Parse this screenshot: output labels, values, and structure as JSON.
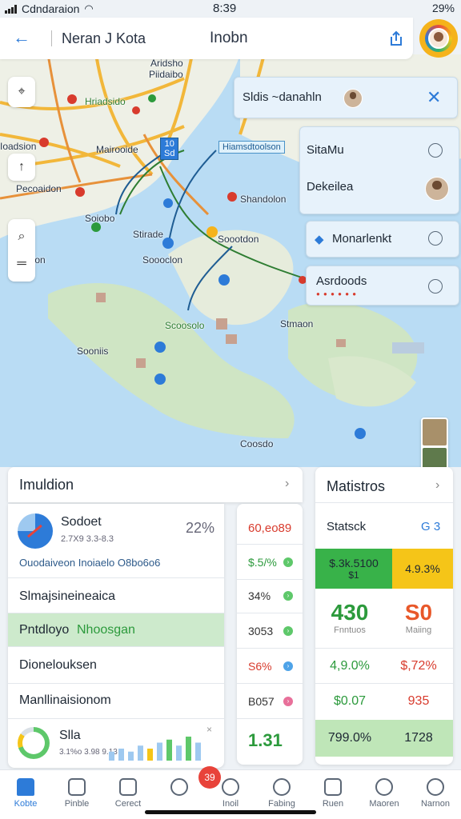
{
  "status_bar": {
    "carrier": "Cdndaraion",
    "time": "8:39",
    "battery": "29%"
  },
  "header": {
    "back_label": "←",
    "location_title": "Neran J Kota",
    "title": "Inobn"
  },
  "map": {
    "labels": [
      "Aridsho",
      "Piidaibo",
      "Hriadsido",
      "Ioadsion",
      "Mairooide",
      "Pecoaidon",
      "Soiobo",
      "Stirade",
      "Soooclon",
      "Pirdon",
      "Shandolon",
      "Soootdon",
      "Scoosolo",
      "Sooniis",
      "Stmaon",
      "Coosdo"
    ],
    "pin_box_label": "10\nSd",
    "route_box_label": "Hiamsdtoolson"
  },
  "search_popup": {
    "label": "Sldis ~danahln"
  },
  "side_popups": [
    {
      "label": "SitaMu"
    },
    {
      "label": "Dekeilea"
    },
    {
      "label": "Monarlenkt"
    },
    {
      "label": "Asrdoods",
      "sub": "● ● ● ● ● ●"
    }
  ],
  "info_panel": {
    "title": "Imuldion",
    "summary": {
      "name": "Sodoet",
      "detail": "2.7X9 3.3-8.3",
      "percent": "22%"
    },
    "link_row": "Ouodaiveon Inoiaelo O8bo6o6",
    "rows": [
      "Slmajsineineaica",
      "Pntdloyo",
      "Dionelouksen",
      "Manllinaisionom"
    ],
    "highlight_suffix": "Nhoosgan",
    "footer": {
      "name": "Slla",
      "detail": "3.1%o 3.98 9.13"
    }
  },
  "mid_column": {
    "header": "60,eo89",
    "values": [
      "$.5/%",
      "34%",
      "3053",
      "S6%",
      "B057"
    ],
    "total": "1.31"
  },
  "stats_panel": {
    "title": "Matistros",
    "subtitle": "Statsck",
    "subvalue": "G 3",
    "cells": [
      {
        "value": "$.3k.5100",
        "sub": "$1"
      },
      {
        "value": "4.9.3%"
      },
      {
        "value": "430",
        "sub": "Fnntuos"
      },
      {
        "value": "S0",
        "sub": "Maiing"
      },
      {
        "value": "4,9.0%"
      },
      {
        "value": "$,72%"
      },
      {
        "value": "$0.07"
      },
      {
        "value": "935"
      },
      {
        "value": "799.0%"
      },
      {
        "value": "1728"
      }
    ]
  },
  "sparkline": [
    3,
    4,
    3,
    5,
    4,
    6,
    7,
    5,
    8,
    6
  ],
  "bottom_nav": {
    "items": [
      "Kobte",
      "Pinble",
      "Cerect",
      "",
      "Inoil",
      "Fabing",
      "Ruen",
      "Maoren",
      "Narnon"
    ],
    "badge": "39"
  },
  "colors": {
    "accent": "#2d7bd8",
    "green": "#2c9a3c",
    "red": "#d83b2d",
    "yellow": "#f5c518"
  }
}
